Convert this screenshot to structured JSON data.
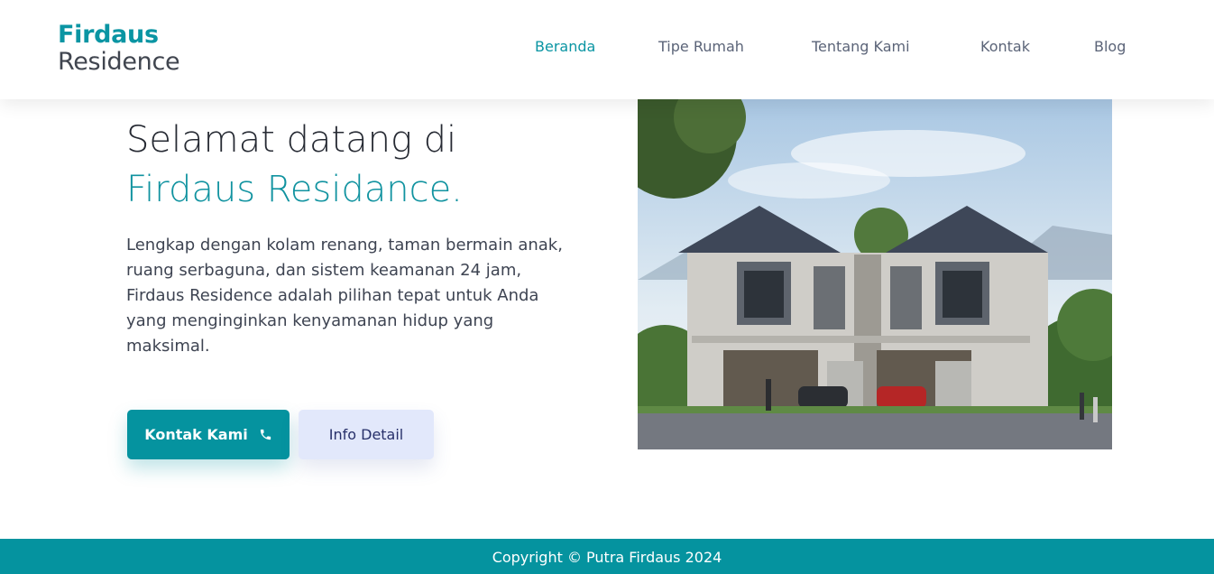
{
  "brand": {
    "name_line1": "Firdaus",
    "name_line2": "Residence"
  },
  "nav": {
    "items": [
      {
        "label": "Beranda",
        "active": true
      },
      {
        "label": "Tipe Rumah",
        "active": false
      },
      {
        "label": "Tentang Kami",
        "active": false
      },
      {
        "label": "Kontak",
        "active": false
      },
      {
        "label": "Blog",
        "active": false
      }
    ]
  },
  "hero": {
    "title_line1": "Selamat datang di",
    "title_line2": "Firdaus Residance.",
    "description": "Lengkap dengan kolam renang, taman bermain anak, ruang serbaguna, dan sistem keamanan 24 jam, Firdaus Residence adalah pilihan tepat untuk Anda yang menginginkan kenyamanan hidup yang maksimal.",
    "primary_button": "Kontak Kami",
    "primary_button_icon": "phone-icon",
    "secondary_button": "Info Detail",
    "image": "house-photo"
  },
  "footer": {
    "copyright": "Copyright © Putra Firdaus 2024"
  },
  "colors": {
    "accent": "#0a95a3",
    "footer_bg": "#05939f",
    "secondary_btn_bg": "#e2e8fb"
  }
}
